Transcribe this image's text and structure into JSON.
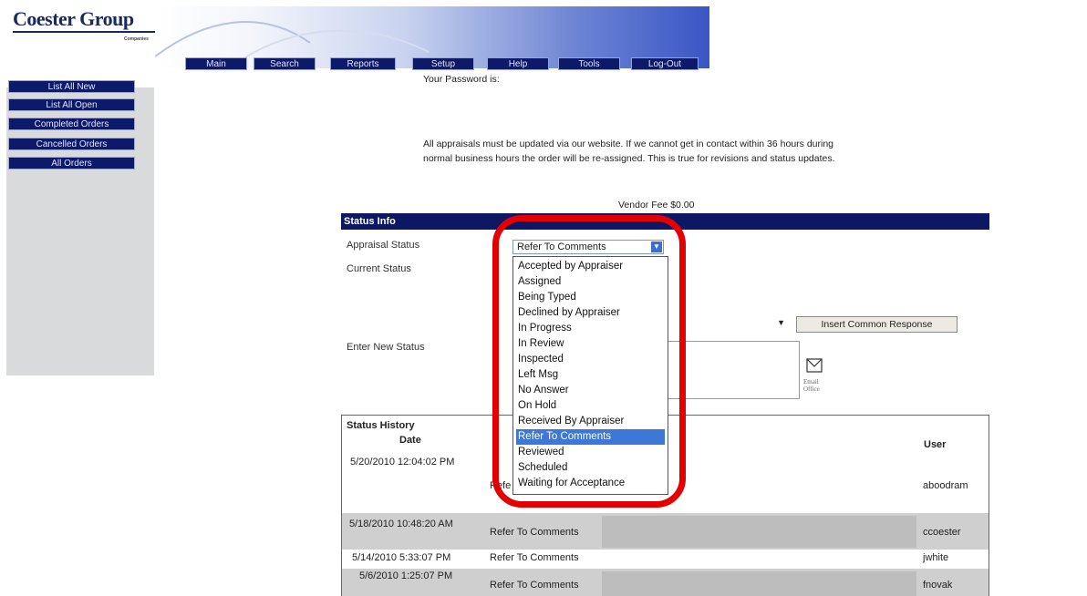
{
  "logo": {
    "name": "Coester Group",
    "sub": "Companies"
  },
  "nav": [
    "Main",
    "Search",
    "Reports",
    "Setup",
    "Help",
    "Tools",
    "Log-Out"
  ],
  "sidebar": [
    "List All New",
    "List All Open",
    "Completed Orders",
    "Cancelled Orders",
    "All Orders"
  ],
  "password_label": "Your Password is:",
  "notice": "All appraisals must be updated via our website. If we cannot get in contact within 36 hours during normal business hours the order will be re-assigned. This is true for revisions and status updates.",
  "vendor_fee": "Vendor Fee $0.00",
  "status_info": {
    "header": "Status Info",
    "appraisal_status_label": "Appraisal Status",
    "current_status_label": "Current Status",
    "enter_new_status_label": "Enter New Status",
    "selected": "Refer To Comments",
    "options": [
      "Accepted by Appraiser",
      "Assigned",
      "Being Typed",
      "Declined by Appraiser",
      "In Progress",
      "In Review",
      "Inspected",
      "Left Msg",
      "No Answer",
      "On Hold",
      "Received By Appraiser",
      "Refer To Comments",
      "Reviewed",
      "Scheduled",
      "Waiting for Acceptance"
    ],
    "highlighted_option": "Refer To Comments",
    "insert_common_response": "Insert Common Response",
    "email_office": "Email Office"
  },
  "history": {
    "title": "Status History",
    "col_date": "Date",
    "col_user": "User",
    "rows": [
      {
        "date": "5/20/2010 12:04:02 PM",
        "status": "Refe",
        "user": "aboodram"
      },
      {
        "date": "5/18/2010 10:48:20 AM",
        "status": "Refer To Comments",
        "user": "ccoester"
      },
      {
        "date": "5/14/2010 5:33:07 PM",
        "status": "Refer To Comments",
        "user": "jwhite"
      },
      {
        "date": "5/6/2010 1:25:07 PM",
        "status": "Refer To Comments",
        "user": "fnovak"
      }
    ]
  },
  "colors": {
    "nav_bg": "#0d1a6a",
    "header_bar": "#0e1763",
    "highlight": "#3d78d8",
    "annotation": "#e30000"
  }
}
